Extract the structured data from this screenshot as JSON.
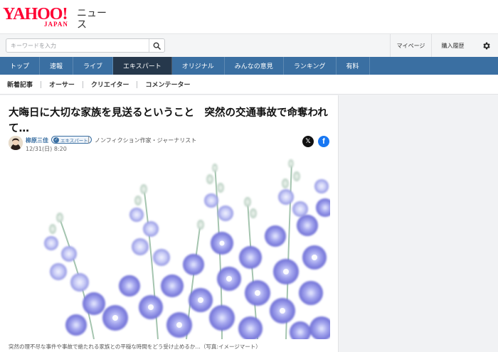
{
  "header": {
    "logo_text": "YAHOO!",
    "logo_sub": "JAPAN",
    "service_name": "ニュース"
  },
  "search": {
    "placeholder": "キーワードを入力",
    "value": "",
    "button_icon": "search-icon"
  },
  "utility": {
    "mypage_label": "マイページ",
    "history_label": "購入履歴",
    "settings_icon": "gear-icon"
  },
  "nav": {
    "items": [
      {
        "label": "トップ"
      },
      {
        "label": "速報"
      },
      {
        "label": "ライブ"
      },
      {
        "label": "エキスパート"
      },
      {
        "label": "オリジナル"
      },
      {
        "label": "みんなの意見"
      },
      {
        "label": "ランキング"
      },
      {
        "label": "有料"
      }
    ],
    "active_index": 3,
    "bar_color": "#3a6fa2",
    "active_color": "#26384c"
  },
  "subnav": {
    "items": [
      {
        "label": "新着記事"
      },
      {
        "label": "オーサー"
      },
      {
        "label": "クリエイター"
      },
      {
        "label": "コメンテーター"
      }
    ]
  },
  "article": {
    "title": "大晦日に大切な家族を見送るということ　突然の交通事故で命奪われて…",
    "author_name": "柳原三佳",
    "author_badge": "エキスパート",
    "author_title": "ノンフィクション作家・ジャーナリスト",
    "date": "12/31(日) 8:20",
    "share_x_icon": "x-logo-icon",
    "share_facebook_icon": "facebook-icon",
    "photo_caption": "突然の理不尽な事件や事故で絶たれる家族との平穏な時間をどう受け止めるか…（写真:イメージマート）"
  }
}
